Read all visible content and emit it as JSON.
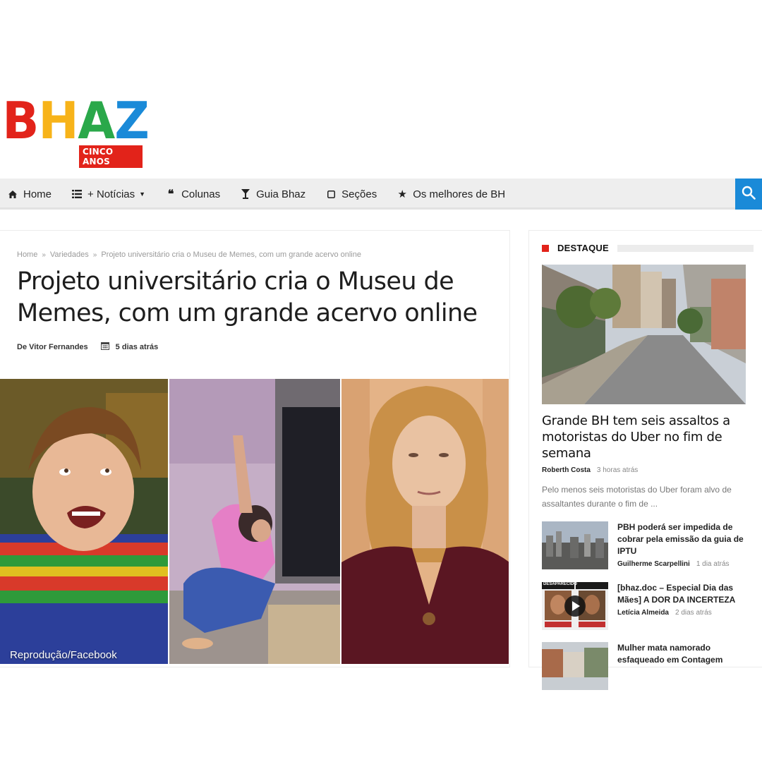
{
  "logo": {
    "letters": [
      {
        "char": "B",
        "color": "#e2231a"
      },
      {
        "char": "H",
        "color": "#f7b319"
      },
      {
        "char": "A",
        "color": "#2aa84a"
      },
      {
        "char": "Z",
        "color": "#1a8ad8"
      }
    ],
    "subtitle": "CINCO ANOS"
  },
  "nav": {
    "items": [
      {
        "icon": "home-icon",
        "label": "Home"
      },
      {
        "icon": "list-icon",
        "label": "+ Notícias",
        "dropdown": true
      },
      {
        "icon": "quote-icon",
        "label": "Colunas"
      },
      {
        "icon": "cocktail-icon",
        "label": "Guia Bhaz"
      },
      {
        "icon": "square-icon",
        "label": "Seções"
      },
      {
        "icon": "star-icon",
        "label": "Os melhores de BH"
      }
    ],
    "search_icon": "search-icon",
    "accent": "#1a8ad8"
  },
  "article": {
    "breadcrumb": [
      "Home",
      "Variedades",
      "Projeto universitário cria o Museu de Memes, com um grande acervo online"
    ],
    "title": "Projeto universitário cria o Museu de Memes, com um grande acervo online",
    "author": "De Vitor Fernandes",
    "time": "5 dias atrás",
    "image_credit": "Reprodução/Facebook"
  },
  "sidebar": {
    "heading": "DESTAQUE",
    "featured": {
      "title": "Grande BH tem seis assaltos a motoristas do Uber no fim de semana",
      "author": "Roberth Costa",
      "time": "3 horas atrás",
      "excerpt": "Pelo menos seis motoristas do Uber foram alvo de assaltantes durante o fim de ..."
    },
    "items": [
      {
        "title": "PBH poderá ser impedida de cobrar pela emissão da guia de IPTU",
        "author": "Guilherme Scarpellini",
        "time": "1 dia atrás"
      },
      {
        "title": "[bhaz.doc – Especial Dia das Mães] A DOR DA INCERTEZA",
        "author": "Letícia Almeida",
        "time": "2 dias atrás",
        "thumb_label": "DESAPARECIDO"
      },
      {
        "title": "Mulher mata namorado esfaqueado em Contagem"
      }
    ]
  }
}
